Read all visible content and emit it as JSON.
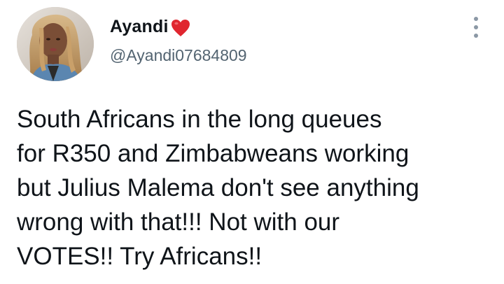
{
  "author": {
    "display_name": "Ayandi",
    "handle": "@Ayandi07684809",
    "badge_icon": "red-heart-emoji",
    "avatar": "profile-photo"
  },
  "menu": {
    "icon": "vertical-ellipsis-icon"
  },
  "tweet": {
    "lines": [
      "South Africans in the long queues",
      "for R350 and Zimbabweans working",
      "but Julius Malema don't see anything",
      "wrong with that!!! Not with our",
      "VOTES!! Try Africans!!"
    ]
  },
  "colors": {
    "text": "#0f1419",
    "secondary": "#536471",
    "heart": "#e0262f",
    "more_dots": "#8b98a5"
  }
}
